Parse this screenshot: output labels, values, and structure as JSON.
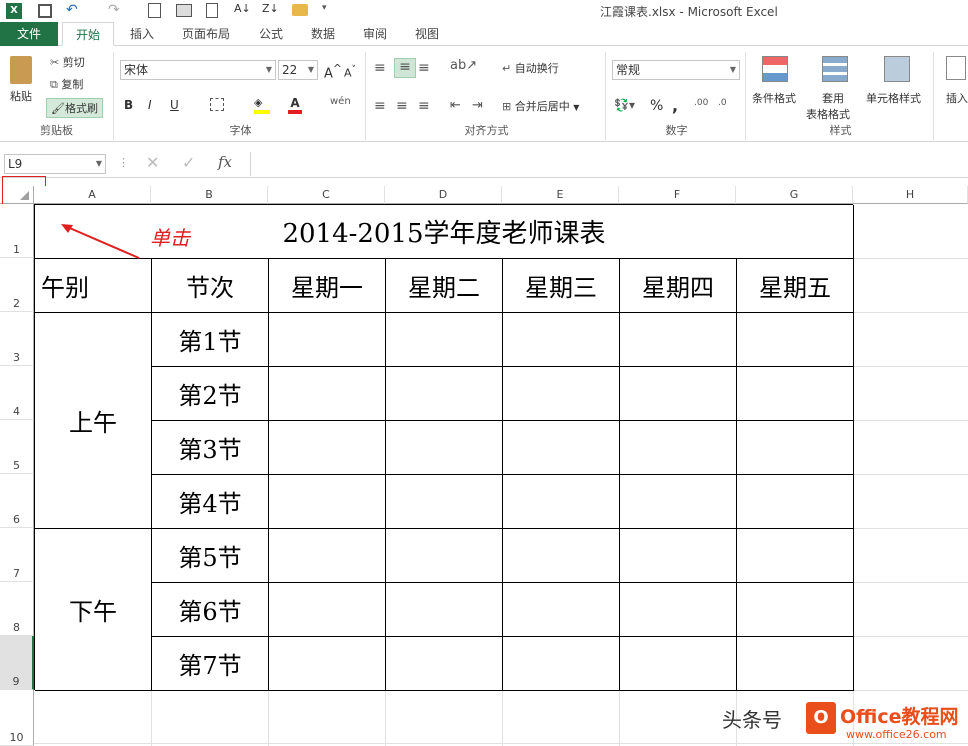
{
  "window": {
    "title": "江霞课表.xlsx - Microsoft Excel"
  },
  "tabs": [
    "文件",
    "开始",
    "插入",
    "页面布局",
    "公式",
    "数据",
    "审阅",
    "视图"
  ],
  "clipboard": {
    "paste": "粘贴",
    "cut": "剪切",
    "copy": "复制",
    "format_painter": "格式刷",
    "label": "剪贴板"
  },
  "font": {
    "name": "宋体",
    "size": "22",
    "bold": "B",
    "italic": "I",
    "underline": "U",
    "label": "字体"
  },
  "alignment": {
    "wrap": "自动换行",
    "merge": "合并后居中",
    "label": "对齐方式"
  },
  "number": {
    "format": "常规",
    "percent": "%",
    "comma": ",",
    "label": "数字"
  },
  "styles": {
    "cond": "条件格式",
    "table": "套用",
    "table2": "表格格式",
    "cell": "单元格样式",
    "label": "样式"
  },
  "cells_grp": {
    "insert": "插入"
  },
  "formula": {
    "namebox": "L9",
    "fx": "fx"
  },
  "columns": [
    "A",
    "B",
    "C",
    "D",
    "E",
    "F",
    "G",
    "H"
  ],
  "rows": [
    "1",
    "2",
    "3",
    "4",
    "5",
    "6",
    "7",
    "8",
    "9",
    "10"
  ],
  "sheet": {
    "title": "2014-2015学年度老师课表",
    "h_period": "午别",
    "h_section": "节次",
    "days": [
      "星期一",
      "星期二",
      "星期三",
      "星期四",
      "星期五"
    ],
    "morning": "上午",
    "afternoon": "下午",
    "sections": [
      "第1节",
      "第2节",
      "第3节",
      "第4节",
      "第5节",
      "第6节",
      "第7节"
    ]
  },
  "annotation": {
    "text": "单击",
    "color": "#e02020"
  },
  "watermark": {
    "text1": "头条号",
    "text2": "Office教程网",
    "url": "www.office26.com"
  }
}
